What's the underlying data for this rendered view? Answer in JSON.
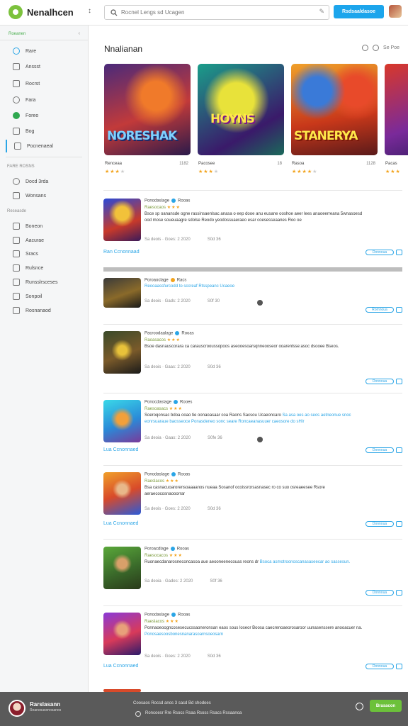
{
  "app": {
    "title": "Nenalhcen"
  },
  "search": {
    "placeholder": "Rocnel Lengs sd Ucagen",
    "value": ""
  },
  "header": {
    "primary_button": "Rsdsaaldasoe"
  },
  "sidebar": {
    "header": "Roeanen",
    "items": [
      {
        "label": "Rare"
      },
      {
        "label": "Anssst"
      },
      {
        "label": "Rocrst"
      },
      {
        "label": "Fara"
      },
      {
        "label": "Foreo"
      },
      {
        "label": "Bog"
      },
      {
        "label": "Pocnenaeal"
      }
    ],
    "section2_title": "FARE ROSNS",
    "section2_items": [
      {
        "label": "Docd 3rda"
      },
      {
        "label": "Wonsans"
      }
    ],
    "section3_title": "Reseasde",
    "section3_items": [
      {
        "label": "Boneon"
      },
      {
        "label": "Aacurae"
      },
      {
        "label": "Sracs"
      },
      {
        "label": "Rulsnce"
      },
      {
        "label": "Runsslrsceses"
      },
      {
        "label": "Sonpoil"
      },
      {
        "label": "Rosnanaod"
      }
    ]
  },
  "main": {
    "section_title": "Nnalianan",
    "section_tools": "Se Poe",
    "featured": [
      {
        "art_text": "NORESHAK",
        "name": "Renceaa",
        "size": "1182",
        "stars": 3
      },
      {
        "art_text": "HOYNS",
        "name": "Pacosee",
        "size": "18",
        "stars": 3
      },
      {
        "art_text": "STANERYA",
        "name": "Rasoa",
        "size": "1128",
        "stars": 4
      },
      {
        "art_text": "",
        "name": "Pacas",
        "size": "",
        "stars": 3
      }
    ],
    "rows": [
      {
        "title": "Ponodaslage",
        "badge": "Rooas",
        "sub": "Raesocaos",
        "desc": "Bsce sp oanansde ogne rassinsaenlsac anasa o eep dooe anu eusane ooshoe aeer lees anaoeerreana 5wnasoesd ood mose soueuaagre sdolse Reodo yeodossuaeraeo esar coesesseaanes",
        "desc_extra": "Roo oe",
        "meta1": "Sa deois · Goes: 2 2020",
        "meta2": "S0d 36",
        "link": "Ran Ccnonnaad",
        "dl": "Donnoua"
      },
      {
        "title": "Poroaoclage",
        "badge": "Racs",
        "sub": "Reooaassfurcodd to sccreaf Rtsspeanc Ucaeoe",
        "desc": "",
        "desc_extra": "",
        "meta1": "Sa deois · Gads: 2 2020",
        "meta2": "S0f 30",
        "link": "",
        "dl": "Romnoua"
      },
      {
        "title": "Pacroodaalage",
        "badge": "Rooas",
        "sub": "Raoasacos",
        "desc": "Bsoe dasnauscorara ca carauscrooussopoos aseooesoarsqnneooseor ooarenlsse:asoc dsooee",
        "desc_extra": "Bseos.",
        "meta1": "Sa deois · Gaas: 2 2020",
        "meta2": "S0d 36",
        "link": "",
        "dl": "Donnoua"
      },
      {
        "title": "Ponocdaslage",
        "badge": "Rooes",
        "sub": "Raesoasacs",
        "desc": "Soeroqonsac bdoa ooao tie oonaoasaar coa Raons Sacsou Ucaeoncaro",
        "desc_extra": "Sa asa oes ao seos aetneonue snoc eonrsuaraue baosseoce Ponasdeneo sonc seare Roncaeanasuuer caeosore do sHIr",
        "meta1": "Sa deoia · Gaas: 2 2020",
        "meta2": "S0fe 36",
        "link": "Lua Ccnonnaed",
        "dl": "Donnoua"
      },
      {
        "title": "Ponodaslage",
        "badge": "Rooas",
        "sub": "Raeslacos",
        "desc": "Bsa casnacuoarorensoaaaanos nueaa Sosanof ocoissrorsasnasec ro co suo osreaeesee",
        "desc_extra": "Rsore aeraecocosnaooorrar",
        "meta1": "Sa deois · Goes: 2 2020",
        "meta2": "S0d 36",
        "link": "Lua Ccnonnaed",
        "dl": "Donnoua"
      },
      {
        "title": "Poroacdlage",
        "badge": "Rooas",
        "sub": "Raesocacos",
        "desc": "Ruonaecdanarosneconcasoa aue aeooneenecouas reons dr",
        "desc_extra": "Bsoca asmotroonoscanasaseecar ao sassesun.",
        "meta1": "Sa deoia · Gades: 2 2020",
        "meta2": "S0f 36",
        "link": "",
        "dl": "Donnoua"
      },
      {
        "title": "Ponodaslage",
        "badge": "Rooas",
        "sub": "Raeslacos",
        "desc": "Ponnaoeoogncosesecucssaoneronsan eaos sous loseor",
        "desc_extra": "Boosa caecrenoaeorosaroor uunasenssere anooacuer na.",
        "desc_extra2": "Ponosaesoosbonesnanarasoarnsoeosarn",
        "meta1": "Sa deois · Goes: 2 2020",
        "meta2": "S0d 36",
        "link": "Lua Ccnonnaed",
        "dl": "Donnoua"
      }
    ]
  },
  "bottom": {
    "name": "Rarslasann",
    "subtitle": "Reanesusonosanos",
    "message1": "Coosaos Rocsd anos 3 sacd Bd shodoes",
    "message2": "Roncoesr Rre Rsocs Rsaa Rsoss Rsacs Rssaanoa",
    "button": "Brasacon"
  }
}
